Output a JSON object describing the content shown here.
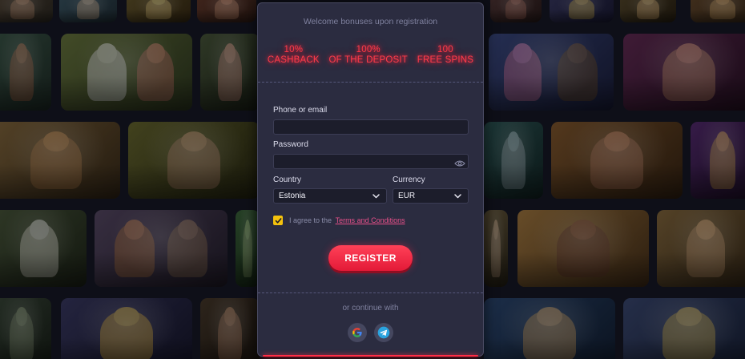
{
  "registration": {
    "title": "Welcome bonuses upon registration",
    "bonuses": [
      {
        "line1": "10%",
        "line2": "CASHBACK"
      },
      {
        "line1": "100%",
        "line2": "OF THE DEPOSIT"
      },
      {
        "line1": "100",
        "line2": "FREE SPINS"
      }
    ],
    "fields": {
      "phone_label": "Phone or email",
      "phone_value": "",
      "password_label": "Password",
      "password_value": "",
      "country_label": "Country",
      "country_value": "Estonia",
      "currency_label": "Currency",
      "currency_value": "EUR"
    },
    "agree": {
      "text": "I agree to the",
      "link": "Terms and Conditions",
      "checked": true
    },
    "register_label": "REGISTER",
    "continue_label": "or continue with",
    "social": [
      "google-icon",
      "telegram-icon"
    ]
  },
  "colors": {
    "accent": "#ff2d46",
    "checkbox": "#f4c20d",
    "modal_bg": "#2b2c40",
    "link": "#e8508a"
  }
}
